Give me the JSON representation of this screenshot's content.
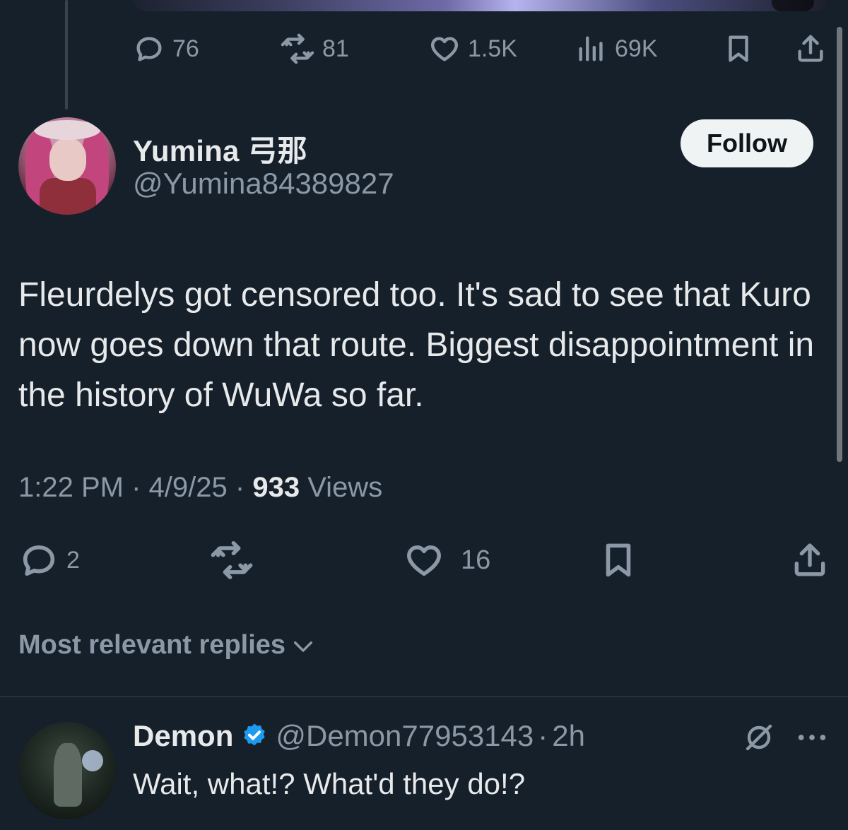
{
  "parent_tweet": {
    "actions": {
      "replies": "76",
      "reposts": "81",
      "likes": "1.5K",
      "views": "69K"
    }
  },
  "tweet": {
    "display_name": "Yumina 弓那",
    "handle": "@Yumina84389827",
    "follow_label": "Follow",
    "text": "Fleurdelys got censored too. It's sad to see that Kuro now goes down that route. Biggest disappointment in the history of WuWa so far.",
    "time": "1:22 PM",
    "date": "4/9/25",
    "views_count": "933",
    "views_label": "Views",
    "sep": "·",
    "actions": {
      "replies": "2",
      "likes": "16"
    }
  },
  "replies_sort": {
    "label": "Most relevant replies"
  },
  "reply": {
    "display_name": "Demon",
    "handle": "@Demon77953143",
    "sep": "·",
    "time": "2h",
    "text": "Wait, what!? What'd they do!?"
  },
  "colors": {
    "background": "#15202b",
    "text_primary": "#e7e9ea",
    "text_secondary": "#8b98a5",
    "verified": "#1d9bf0"
  }
}
